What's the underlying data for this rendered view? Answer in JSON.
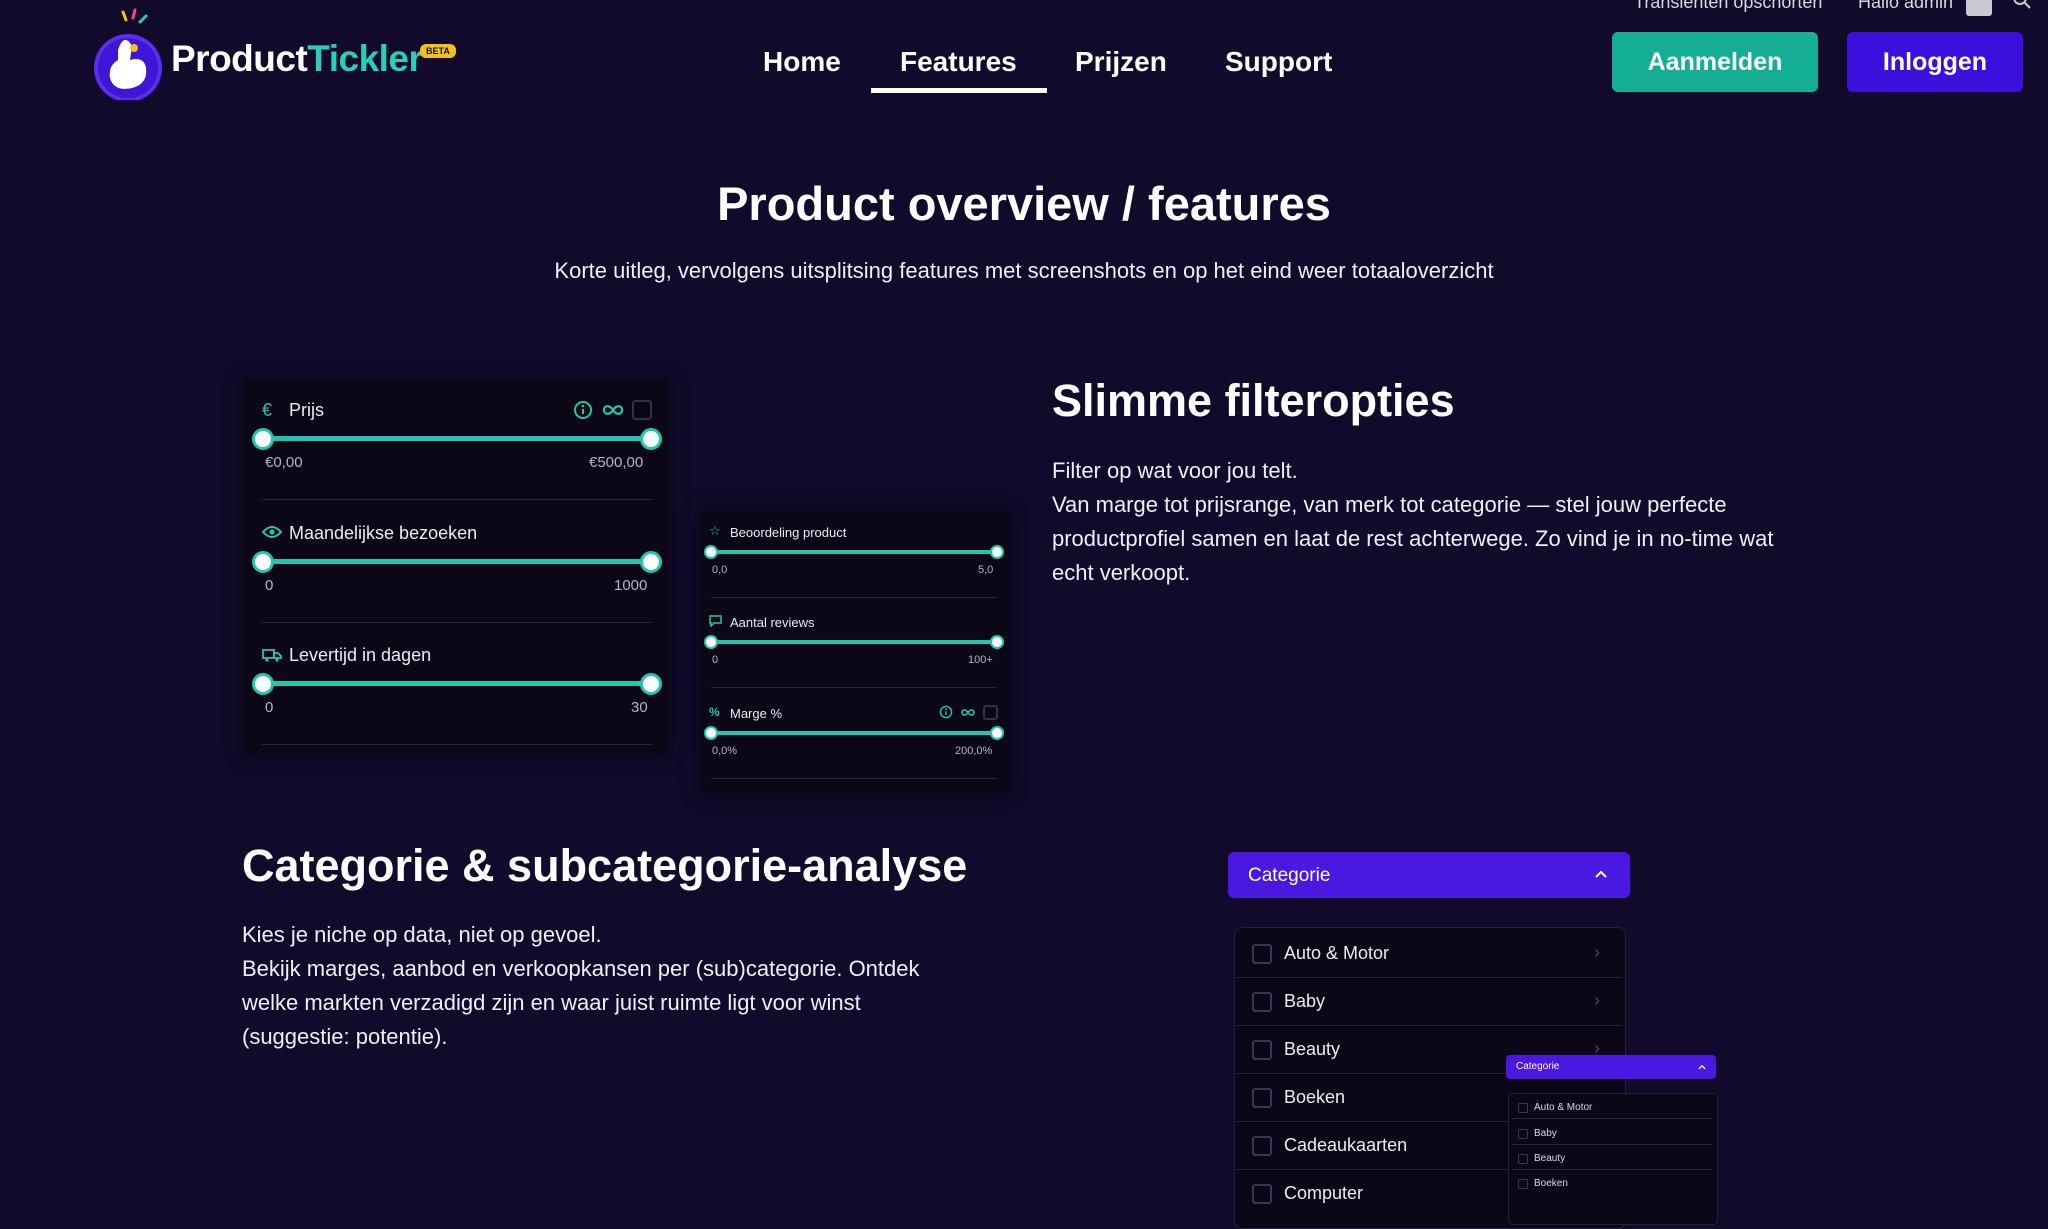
{
  "topbar": {
    "left_text": "Translenten opschorten",
    "greeting": "Hallo admin"
  },
  "logo": {
    "part1": "Product",
    "part2": "Tickler",
    "badge": "BETA"
  },
  "nav": {
    "home": "Home",
    "features": "Features",
    "pricing": "Prijzen",
    "support": "Support",
    "active": "Features"
  },
  "buttons": {
    "signup": "Aanmelden",
    "login": "Inloggen"
  },
  "hero": {
    "title": "Product overview / features",
    "subtitle": "Korte uitleg, vervolgens uitsplitsing features met screenshots en op het eind weer totaaloverzicht"
  },
  "filter_panel_1": {
    "price": {
      "label": "Prijs",
      "min": "€0,00",
      "max": "€500,00"
    },
    "visits": {
      "label": "Maandelijkse bezoeken",
      "min": "0",
      "max": "1000"
    },
    "delivery": {
      "label": "Levertijd in dagen",
      "min": "0",
      "max": "30"
    }
  },
  "filter_panel_2": {
    "rating": {
      "label": "Beoordeling product",
      "min": "0,0",
      "max": "5,0"
    },
    "reviews": {
      "label": "Aantal reviews",
      "min": "0",
      "max": "100+"
    },
    "margin": {
      "label": "Marge %",
      "min": "0,0%",
      "max": "200,0%"
    }
  },
  "section_filters": {
    "title": "Slimme filteropties",
    "lines": [
      "Filter op wat voor jou telt.",
      "Van marge tot prijsrange, van merk tot categorie — stel jouw perfecte",
      "productprofiel samen en laat de rest achterwege. Zo vind je in no-time wat",
      "echt verkoopt."
    ]
  },
  "section_categories": {
    "title": "Categorie & subcategorie-analyse",
    "lines": [
      "Kies je niche op data, niet op gevoel.",
      "Bekijk marges, aanbod en verkoopkansen per (sub)categorie. Ontdek",
      "welke markten verzadigd zijn en waar juist ruimte ligt voor winst",
      "(suggestie: potentie)."
    ]
  },
  "category_widget": {
    "header": "Categorie",
    "items": [
      "Auto & Motor",
      "Baby",
      "Beauty",
      "Boeken",
      "Cadeaukaarten",
      "Computer"
    ]
  },
  "category_widget_mini": {
    "header": "Categorie",
    "items": [
      "Auto & Motor",
      "Baby",
      "Beauty",
      "Boeken"
    ]
  },
  "colors": {
    "background": "#120a2a",
    "accent_teal": "#13ae94",
    "accent_purple": "#3b10dc",
    "slider": "#22c6ac"
  }
}
